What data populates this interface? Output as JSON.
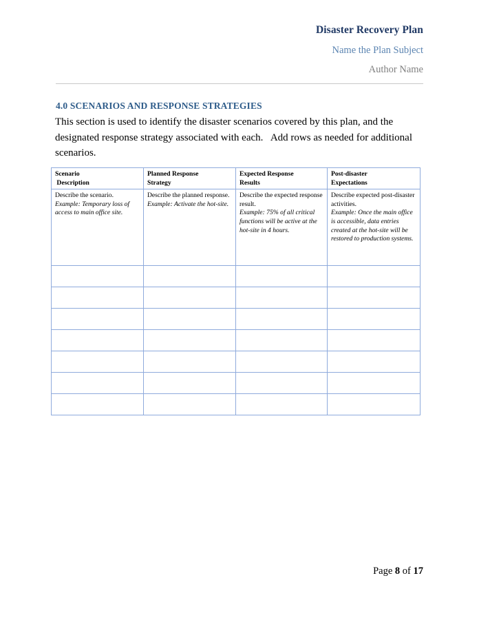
{
  "header": {
    "title": "Disaster Recovery Plan",
    "subtitle": "Name the Plan Subject",
    "author": "Author Name"
  },
  "section": {
    "heading": "4.0 SCENARIOS AND RESPONSE STRATEGIES",
    "body": "This section is used to identify the disaster scenarios covered by this plan, and the designated response strategy associated with each.   Add rows as needed for additional scenarios."
  },
  "table": {
    "headers": [
      {
        "line1": "Scenario",
        "line2": " Description"
      },
      {
        "line1": "Planned Response",
        "line2": "Strategy"
      },
      {
        "line1": "Expected Response",
        "line2": "Results"
      },
      {
        "line1": "Post-disaster",
        "line2": "Expectations"
      }
    ],
    "example_row": [
      {
        "lead": "Describe the scenario.",
        "example": "Example: Temporary loss of access to main office site."
      },
      {
        "lead": "Describe the planned response.",
        "example": "Example: Activate the hot-site."
      },
      {
        "lead": "Describe the expected response result.",
        "example": "Example: 75% of all critical functions will be active at the hot-site in 4 hours."
      },
      {
        "lead": "Describe expected post-disaster activities.",
        "example": "Example: Once the main office is accessible, data entries created at the hot-site will be restored to production systems."
      }
    ],
    "empty_row_count": 7,
    "border_color": "#8EAADC"
  },
  "footer": {
    "prefix": "Page ",
    "page_number": "8",
    "middle": " of ",
    "total_pages": "17"
  },
  "colors": {
    "title": "#1F3864",
    "subtitle": "#5B84B1",
    "author": "#808080",
    "heading": "#2E5C8A",
    "rule": "#C8C8C8",
    "table_border": "#8EAADC"
  }
}
